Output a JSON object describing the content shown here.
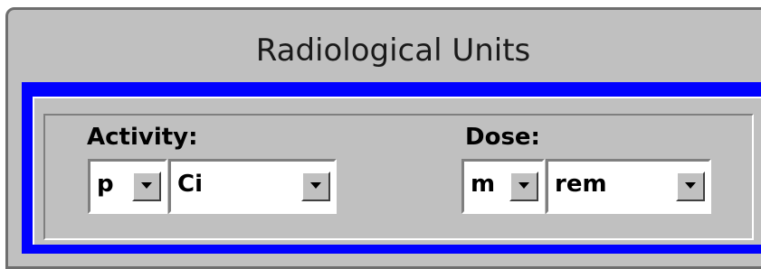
{
  "window": {
    "title": "Radiological Units"
  },
  "activity": {
    "label": "Activity:",
    "prefix": {
      "value": "p"
    },
    "unit": {
      "value": "Ci"
    }
  },
  "dose": {
    "label": "Dose:",
    "prefix": {
      "value": "m"
    },
    "unit": {
      "value": "rem"
    }
  },
  "colors": {
    "frame": "#0000ff",
    "face": "#c0c0c0"
  },
  "icons": {
    "dropdown": "chevron-down-icon"
  }
}
